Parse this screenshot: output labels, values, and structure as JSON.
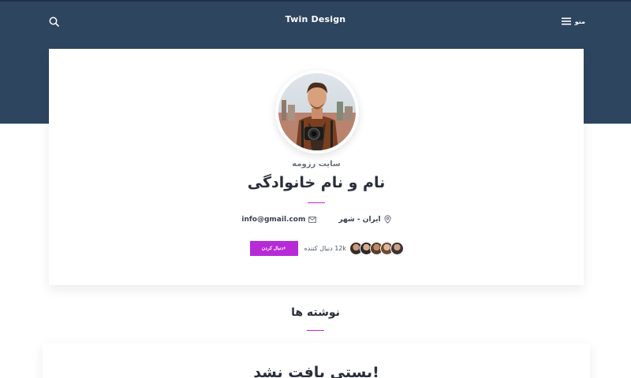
{
  "header": {
    "brand": "Twin Design",
    "menu_label": "منو",
    "search_icon": "search-icon",
    "menu_icon": "hamburger-icon",
    "background": "#2e4560"
  },
  "profile": {
    "site_label": "سایت رزومه",
    "name": "نام و نام خانوادگی",
    "location": "ایران - شهر",
    "email": "info@gmail.com",
    "followers_count": "12k",
    "followers_label": "دنبال کننده",
    "follow_button": "+دنبال کردن",
    "accent_color": "#b62bd6"
  },
  "posts": {
    "section_title": "نوشته ها",
    "empty_message": "پستی یافت نشد!"
  }
}
